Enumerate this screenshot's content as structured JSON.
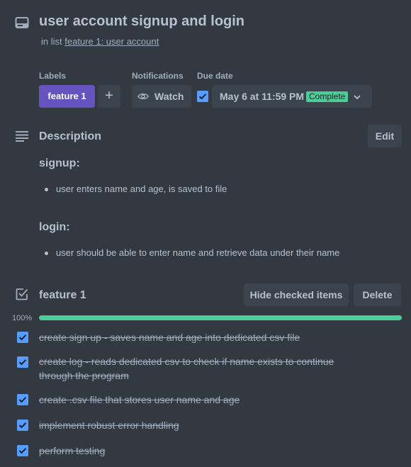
{
  "card": {
    "title": "user account signup and login",
    "in_list_prefix": "in list",
    "list_name": "feature 1: user account"
  },
  "labels_section": {
    "heading": "Labels",
    "labels": [
      {
        "text": "feature 1",
        "color": "#6554c0"
      }
    ],
    "add_symbol": "+"
  },
  "notifications": {
    "heading": "Notifications",
    "watch_label": "Watch",
    "icon": "eye-icon"
  },
  "due_date": {
    "heading": "Due date",
    "checked": true,
    "value": "May 6 at 11:59 PM",
    "status": "Complete",
    "status_color": "#4bce97"
  },
  "description": {
    "heading": "Description",
    "edit_label": "Edit",
    "sections": [
      {
        "heading": "signup:",
        "bullets": [
          "user enters name and age, is saved to file"
        ]
      },
      {
        "heading": "login:",
        "bullets": [
          "user should be able to enter name and retrieve data under their name"
        ]
      }
    ]
  },
  "checklist": {
    "title": "feature 1",
    "hide_label": "Hide checked items",
    "delete_label": "Delete",
    "progress_text": "100%",
    "progress": 1.0,
    "progress_color": "#4bce97",
    "items": [
      {
        "text": "create sign up - saves name and age into dedicated csv file",
        "checked": true
      },
      {
        "text": "create log - reads dedicated csv to check if name exists to continue through the program",
        "checked": true
      },
      {
        "text": "create .csv file that stores user name and age",
        "checked": true
      },
      {
        "text": "implement robust error handling",
        "checked": true
      },
      {
        "text": "perform testing",
        "checked": true
      }
    ]
  }
}
